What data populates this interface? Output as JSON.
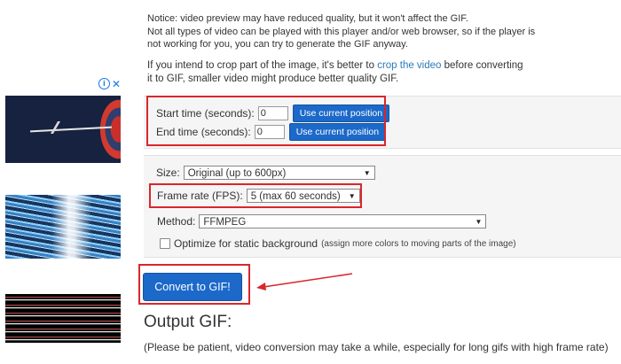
{
  "notice": {
    "line1": "Notice: video preview may have reduced quality, but it won't affect the GIF.",
    "line2": "Not all types of video can be played with this player and/or web browser, so if the player is",
    "line3": "not working for you, you can try to generate the GIF anyway."
  },
  "crop_note": {
    "before": "If you intend to crop part of the image, it's better to",
    "link": "crop the video",
    "after": "before converting",
    "line2": "it to GIF, smaller video might produce better quality GIF."
  },
  "time": {
    "start_label": "Start time (seconds):",
    "start_value": "0",
    "end_label": "End time (seconds):",
    "end_value": "0",
    "use_current_label": "Use current position"
  },
  "options": {
    "size_label": "Size:",
    "size_value": "Original (up to 600px)",
    "fps_label": "Frame rate (FPS):",
    "fps_value": "5 (max 60 seconds)",
    "method_label": "Method:",
    "method_value": "FFMPEG",
    "optimize_label": "Optimize for static background",
    "optimize_note": "(assign more colors to moving parts of the image)",
    "optimize_checked": false
  },
  "convert_label": "Convert to GIF!",
  "output": {
    "title": "Output GIF:",
    "note": "(Please be patient, video conversion may take a while, especially for long gifs with high frame rate)"
  },
  "colors": {
    "accent_blue": "#1c69c9",
    "annotation_red": "#d9262b",
    "link": "#2a7ab8"
  },
  "icons": {
    "ad_info": "info-icon",
    "ad_close": "close-icon",
    "dropdown": "chevron-down-icon"
  }
}
